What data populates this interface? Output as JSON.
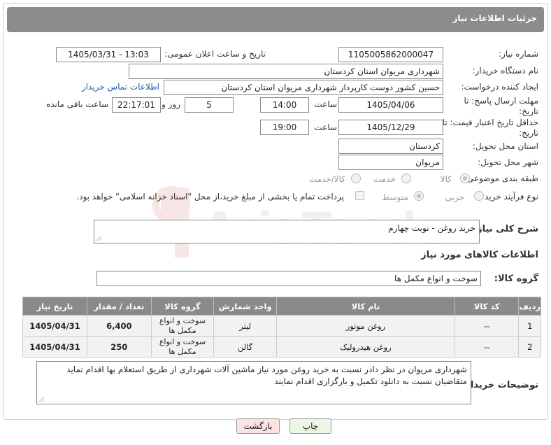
{
  "header": {
    "title": "جزئیات اطلاعات نیاز"
  },
  "form": {
    "need_number_label": "شماره نیاز:",
    "need_number": "1105005862000047",
    "announce_label": "تاریخ و ساعت اعلان عمومی:",
    "announce_value": "1405/03/31 - 13:03",
    "buyer_org_label": "نام دستگاه خریدار:",
    "buyer_org": "شهرداری مریوان استان کردستان",
    "creator_label": "ایجاد کننده درخواست:",
    "creator": "حسین کشور دوست کارپرداز شهرداری مریوان استان کردستان",
    "contact_link": "اطلاعات تماس خریدار",
    "deadline_label": "مهلت ارسال پاسخ: تا تاریخ:",
    "deadline_date": "1405/04/06",
    "hour_label": "ساعت",
    "deadline_time": "14:00",
    "days_value": "5",
    "days_label": "روز و",
    "remaining_time": "22:17:01",
    "remaining_label": "ساعت باقی مانده",
    "price_valid_label": "حداقل تاریخ اعتبار قیمت: تا تاریخ:",
    "price_valid_date": "1405/12/29",
    "price_valid_time": "19:00",
    "province_label": "استان محل تحویل:",
    "province": "کردستان",
    "city_label": "شهر محل تحویل:",
    "city": "مریوان",
    "category_label": "طبقه بندی موضوعی:",
    "category_options": [
      "کالا",
      "خدمت",
      "کالا/خدمت"
    ],
    "process_label": "نوع فرآیند خرید :",
    "process_options": [
      "جزیی",
      "متوسط"
    ],
    "payment_note": "پرداخت تمام یا بخشی از مبلغ خرید،از محل \"اسناد خزانه اسلامی\" خواهد بود.",
    "description_label": "شرح کلی نیاز:",
    "description": "خرید روغن - نوبت چهارم",
    "goods_info_label": "اطلاعات کالاهای مورد نیاز",
    "goods_group_label": "گروه کالا:",
    "goods_group": "سوخت و انواع مکمل ها",
    "buyer_notes_label": "توضیحات خریدار:",
    "buyer_notes": "شهرداری مریوان در نظر دادر نسبت به خرید روغن مورد نیاز ماشین آلات شهرداری از طریق استعلام بها اقدام نماید متقاضیان نسبت به دانلود تکمیل و بارگزاری اقدام نمایند"
  },
  "table": {
    "headers": [
      "ردیف",
      "کد کالا",
      "نام کالا",
      "واحد شمارش",
      "گروه کالا",
      "تعداد / مقدار",
      "تاریخ نیاز"
    ],
    "rows": [
      {
        "row": "1",
        "code": "--",
        "name": "روغن موتور",
        "unit": "لیتر",
        "group": "سوخت و انواع مکمل ها",
        "qty": "6,400",
        "date": "1405/04/31"
      },
      {
        "row": "2",
        "code": "--",
        "name": "روغن هیدرولیک",
        "unit": "گالن",
        "group": "سوخت و انواع مکمل ها",
        "qty": "250",
        "date": "1405/04/31"
      }
    ]
  },
  "buttons": {
    "print": "چاپ",
    "back": "بازگشت"
  },
  "watermark": {
    "text": "AriaTender.neT"
  },
  "colors": {
    "header_bg": "#8c8c8c",
    "print_bg": "#eaf6e6",
    "back_bg": "#fbe3e3",
    "link": "#1f5fb0"
  }
}
